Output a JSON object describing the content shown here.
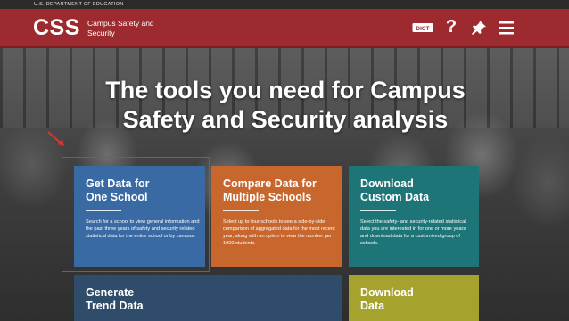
{
  "gov_bar": {
    "text": "U.S. DEPARTMENT OF EDUCATION"
  },
  "header": {
    "logo": "CSS",
    "logo_subtitle": "Campus Safety and Security",
    "icons": [
      "dictionary-icon",
      "help-icon",
      "pin-icon",
      "menu-icon"
    ],
    "dict_label": "DICT",
    "help_label": "?"
  },
  "hero": {
    "title_line1": "The tools you need for Campus",
    "title_line2": "Safety and Security analysis"
  },
  "tiles": [
    {
      "title_line1": "Get Data for",
      "title_line2": "One School",
      "description": "Search for a school to view general information and the past three years of safety  and security related statistical data for the entire school or by campus.",
      "color": "#3a6aa3"
    },
    {
      "title_line1": "Compare Data for",
      "title_line2": "Multiple Schools",
      "description": "Select up to four schools to see a side-by-side comparison of aggregated data for the most recent year, along with an option to view the number per 1000 students.",
      "color": "#c8672d"
    },
    {
      "title_line1": "Download",
      "title_line2": "Custom Data",
      "description": "Select the safety- and security-related statistical data you are interested in for one or more years and download data for a customized group of schools.",
      "color": "#1e7577"
    },
    {
      "title_line1": "Generate",
      "title_line2": "Trend Data",
      "color": "#2f4d6a"
    },
    {
      "title_line1": "Download",
      "title_line2": "Data",
      "color": "#a6a22e"
    }
  ],
  "colors": {
    "header_bg": "#9c2a2f",
    "highlight": "#d8352f"
  }
}
